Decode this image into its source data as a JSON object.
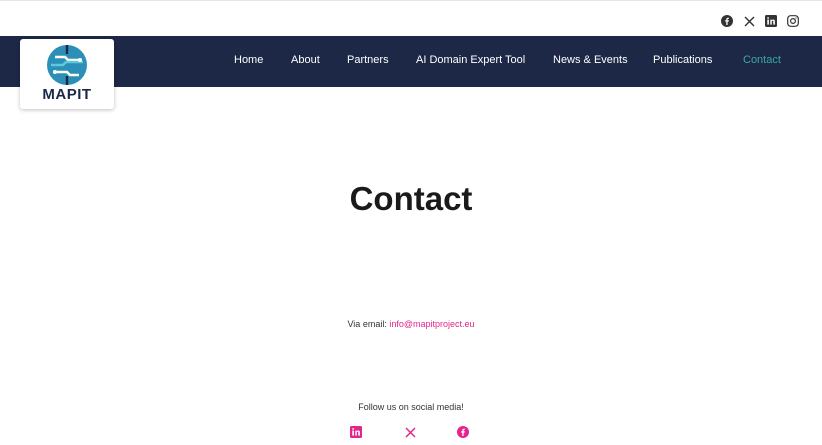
{
  "topbar": {
    "icons": [
      "facebook-icon",
      "x-icon",
      "linkedin-icon",
      "instagram-icon"
    ]
  },
  "logo": {
    "text": "MAPIT"
  },
  "nav": {
    "items": [
      {
        "label": "Home"
      },
      {
        "label": "About"
      },
      {
        "label": "Partners"
      },
      {
        "label": "AI Domain Expert Tool"
      },
      {
        "label": "News & Events"
      },
      {
        "label": "Publications"
      },
      {
        "label": "Contact",
        "active": true
      }
    ]
  },
  "page": {
    "title": "Contact"
  },
  "contact": {
    "email_prefix": "Via email:",
    "email": "info@mapitproject.eu"
  },
  "social": {
    "follow_text": "Follow us on social media!",
    "icons": [
      "linkedin-icon",
      "x-icon",
      "facebook-icon"
    ]
  },
  "colors": {
    "navbar": "#1d2847",
    "active_link": "#3aa7a3",
    "accent": "#e3268a"
  }
}
